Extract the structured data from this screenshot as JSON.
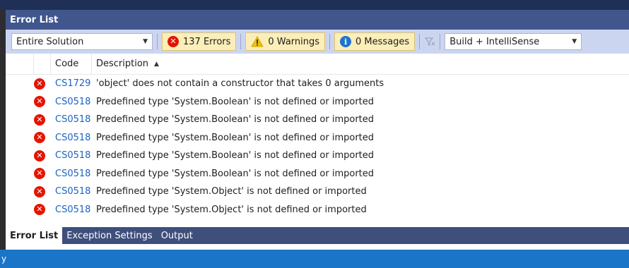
{
  "panel": {
    "title": "Error List"
  },
  "toolbar": {
    "scope": "Entire Solution",
    "errors_label": "137 Errors",
    "warnings_label": "0 Warnings",
    "messages_label": "0 Messages",
    "source": "Build + IntelliSense"
  },
  "columns": {
    "code": "Code",
    "description": "Description"
  },
  "rows": [
    {
      "code": "CS1729",
      "description": "'object' does not contain a constructor that takes 0 arguments"
    },
    {
      "code": "CS0518",
      "description": "Predefined type 'System.Boolean' is not defined or imported"
    },
    {
      "code": "CS0518",
      "description": "Predefined type 'System.Boolean' is not defined or imported"
    },
    {
      "code": "CS0518",
      "description": "Predefined type 'System.Boolean' is not defined or imported"
    },
    {
      "code": "CS0518",
      "description": "Predefined type 'System.Boolean' is not defined or imported"
    },
    {
      "code": "CS0518",
      "description": "Predefined type 'System.Boolean' is not defined or imported"
    },
    {
      "code": "CS0518",
      "description": "Predefined type 'System.Object' is not defined or imported"
    },
    {
      "code": "CS0518",
      "description": "Predefined type 'System.Object' is not defined or imported"
    }
  ],
  "tabs": [
    "Error List",
    "Exception Settings",
    "Output"
  ],
  "status": {
    "text": "y"
  },
  "colors": {
    "title_bar": "#40568d",
    "toolbar": "#ccd5f0",
    "filter_active": "#fbeeb8",
    "error_red": "#e51400",
    "info_blue": "#1e74d0",
    "warning_yellow": "#f2c200",
    "code_link": "#1a63c5",
    "status_bar": "#1a74c7"
  },
  "icons": {
    "error": "error-icon",
    "warning": "warning-icon",
    "message": "info-icon",
    "clear_filter": "clear-filter-icon",
    "dropdown": "chevron-down-icon",
    "sort": "sort-ascending-icon"
  }
}
